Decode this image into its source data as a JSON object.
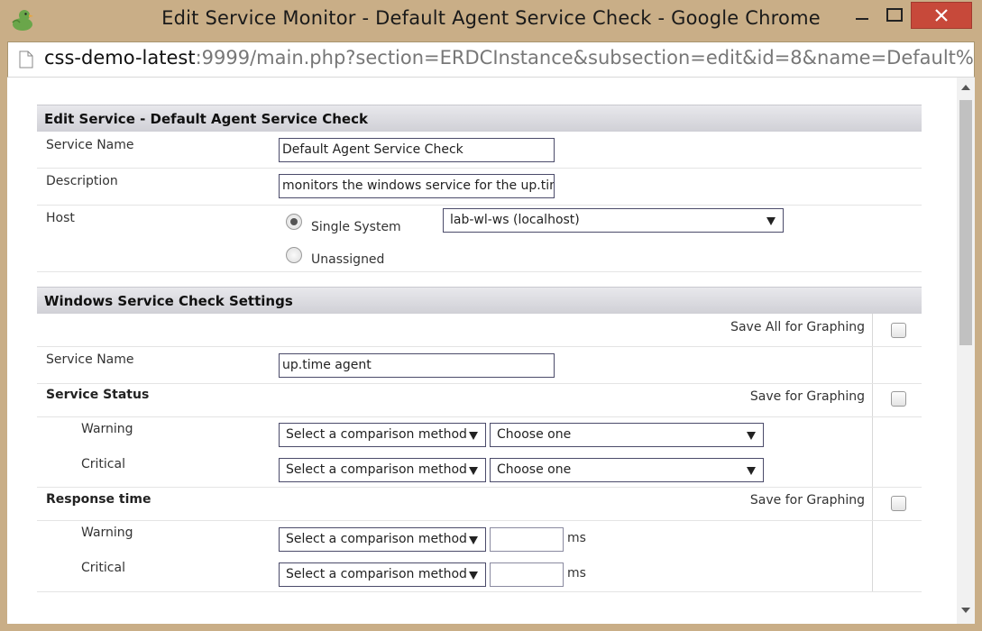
{
  "window": {
    "title": "Edit Service Monitor - Default Agent Service Check - Google Chrome",
    "url_host": "css-demo-latest",
    "url_rest": ":9999/main.php?section=ERDCInstance&subsection=edit&id=8&name=Default%"
  },
  "edit_section": {
    "header": "Edit Service - Default Agent Service Check",
    "service_name_label": "Service Name",
    "service_name_value": "Default Agent Service Check",
    "description_label": "Description",
    "description_value": "monitors the windows service for the up.time agent",
    "host_label": "Host",
    "host_options": {
      "single_system": "Single System",
      "unassigned": "Unassigned",
      "selected": "single_system"
    },
    "host_select_value": "lab-wl-ws (localhost)"
  },
  "settings_section": {
    "header": "Windows Service Check Settings",
    "save_all_label": "Save All for Graphing",
    "service_name_label": "Service Name",
    "service_name_value": "up.time agent",
    "service_status": {
      "label": "Service Status",
      "save_label": "Save for Graphing",
      "warning_label": "Warning",
      "critical_label": "Critical",
      "warning_comparison": "Select a comparison method",
      "warning_value": "Choose one",
      "critical_comparison": "Select a comparison method",
      "critical_value": "Choose one"
    },
    "response_time": {
      "label": "Response time",
      "save_label": "Save for Graphing",
      "warning_label": "Warning",
      "critical_label": "Critical",
      "warning_comparison": "Select a comparison method",
      "warning_value": "",
      "critical_comparison": "Select a comparison method",
      "critical_value": "",
      "unit": "ms"
    }
  },
  "colors": {
    "frame": "#c9ae87",
    "close_button": "#c7493a",
    "header_bg": "#d8d8de",
    "input_border": "#4b4b6a"
  }
}
